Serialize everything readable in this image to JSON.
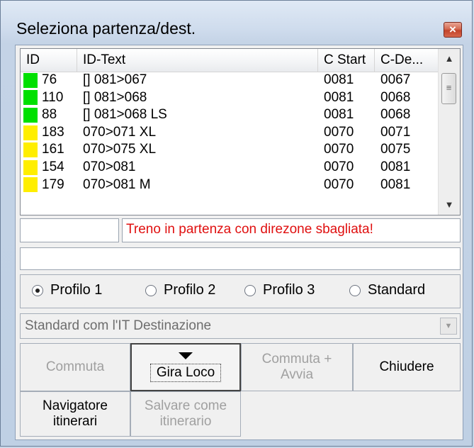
{
  "window": {
    "title": "Seleziona partenza/dest.",
    "close_glyph": "×"
  },
  "table": {
    "headers": [
      "ID",
      "ID-Text",
      "C Start",
      "C-De..."
    ],
    "rows": [
      {
        "color": "#00e000",
        "id": "76",
        "text": "[] 081>067",
        "start": "0081",
        "dest": "0067"
      },
      {
        "color": "#00e000",
        "id": "110",
        "text": "[] 081>068",
        "start": "0081",
        "dest": "0068"
      },
      {
        "color": "#00e000",
        "id": "88",
        "text": "[] 081>068 LS",
        "start": "0081",
        "dest": "0068"
      },
      {
        "color": "#ffee00",
        "id": "183",
        "text": "070>071 XL",
        "start": "0070",
        "dest": "0071"
      },
      {
        "color": "#ffee00",
        "id": "161",
        "text": "070>075 XL",
        "start": "0070",
        "dest": "0075"
      },
      {
        "color": "#ffee00",
        "id": "154",
        "text": "070>081",
        "start": "0070",
        "dest": "0081"
      },
      {
        "color": "#ffee00",
        "id": "179",
        "text": "070>081 M",
        "start": "0070",
        "dest": "0081"
      }
    ]
  },
  "message": {
    "left_value": "",
    "text": "Treno in partenza con direzone sbagliata!"
  },
  "second_field": {
    "value": ""
  },
  "profiles": {
    "options": [
      "Profilo 1",
      "Profilo 2",
      "Profilo 3",
      "Standard"
    ],
    "selected": "Profilo 1"
  },
  "combo": {
    "value": "Standard com l'IT Destinazione"
  },
  "buttons": {
    "commuta": "Commuta",
    "gira_loco": "Gira Loco",
    "commuta_avvia_1": "Commuta +",
    "commuta_avvia_2": "Avvia",
    "chiudere": "Chiudere",
    "navigatore_1": "Navigatore",
    "navigatore_2": "itinerari",
    "salvare_1": "Salvare come",
    "salvare_2": "itinerario"
  }
}
